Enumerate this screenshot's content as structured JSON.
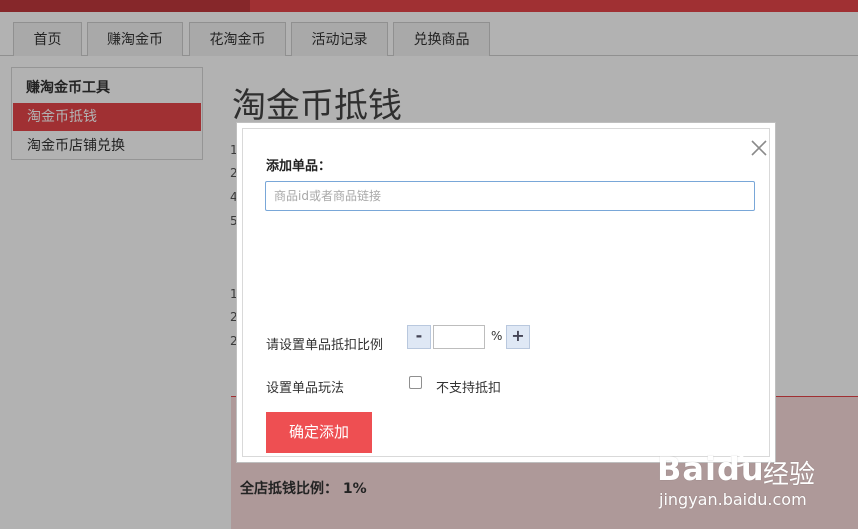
{
  "tabs": [
    {
      "label": "首页"
    },
    {
      "label": "赚淘金币"
    },
    {
      "label": "花淘金币"
    },
    {
      "label": "活动记录"
    },
    {
      "label": "兑换商品"
    }
  ],
  "sidebar": {
    "heading": "赚淘金币工具",
    "items": [
      {
        "label": "淘金币抵钱"
      },
      {
        "label": "淘金币店铺兑换"
      }
    ]
  },
  "page": {
    "title": "淘金币抵钱",
    "rule_numbers": [
      "1",
      "2",
      "4",
      "5",
      "1",
      "2",
      "2"
    ],
    "store_ratio": "全店抵钱比例： 1%"
  },
  "modal": {
    "label": "添加单品：",
    "input_placeholder": "商品id或者商品链接",
    "ratio_label": "请设置单品抵扣比例",
    "minus_label": "-",
    "plus_label": "+",
    "percent": "%",
    "play_label": "设置单品玩法",
    "no_deduct_label": "不支持抵扣",
    "confirm_label": "确定添加",
    "close_icon": "close-icon"
  },
  "watermark": {
    "brand": "Bai",
    "brand_suffix": "du",
    "cn": "经验",
    "url": "jingyan.baidu.com"
  },
  "colors": {
    "accent": "#e5454a",
    "button": "#ee4f52",
    "input_border": "#79a7d8"
  }
}
